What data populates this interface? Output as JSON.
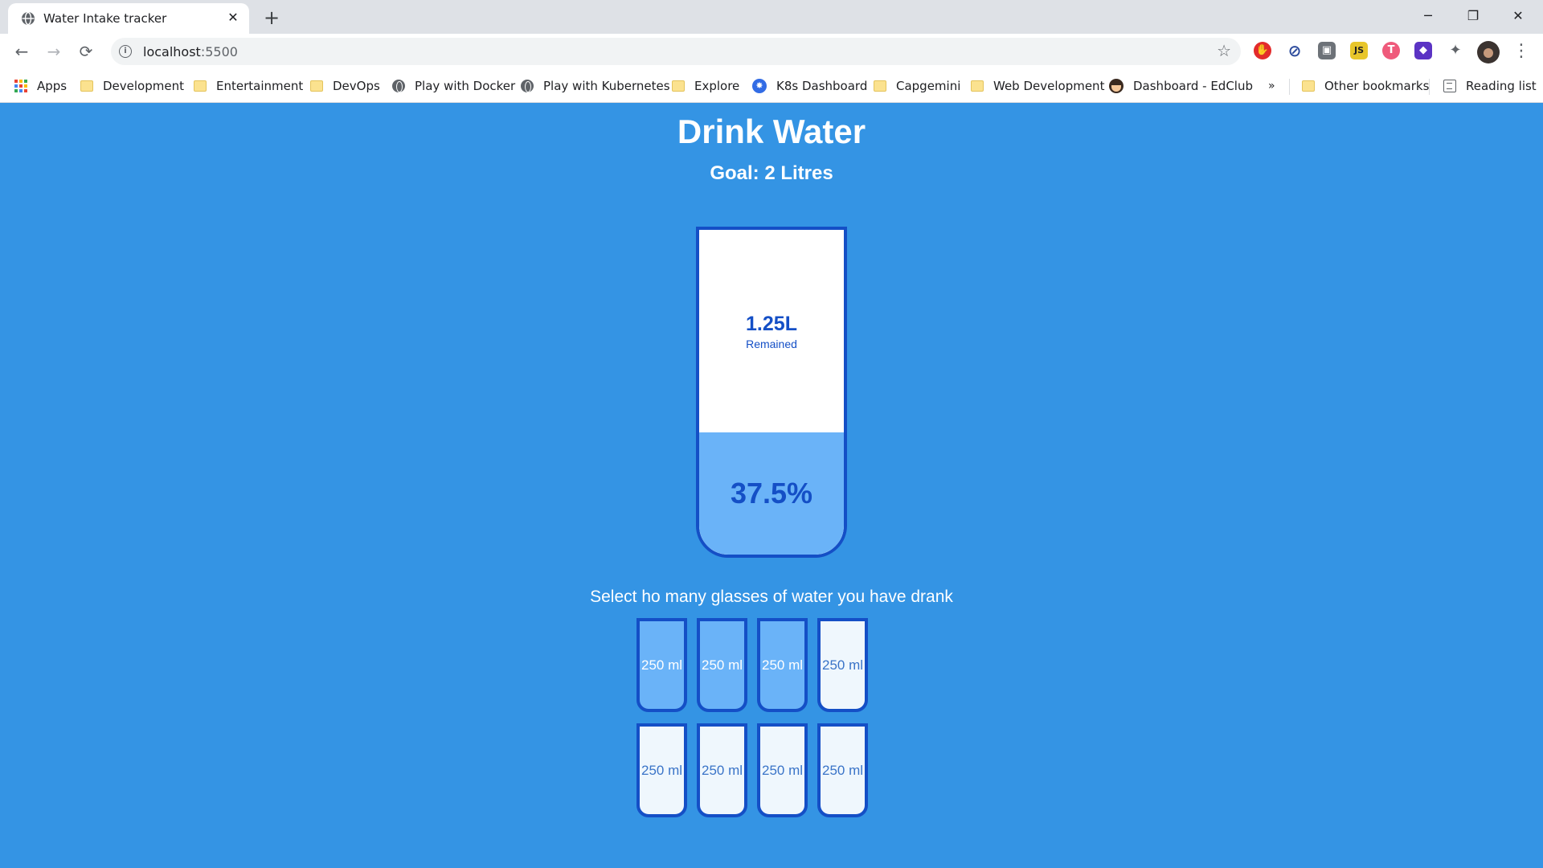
{
  "browser": {
    "tab": {
      "title": "Water Intake tracker",
      "close": "✕",
      "favicon": "globe-icon"
    },
    "new_tab": "+",
    "window_controls": {
      "minimize": "─",
      "restore": "❐",
      "close": "✕"
    },
    "nav": {
      "back": "←",
      "forward": "→",
      "reload": "⟳"
    },
    "omnibox": {
      "host": "localhost",
      "port": ":5500",
      "info": "i",
      "star": "☆"
    },
    "extensions": [
      {
        "name": "adblock-extension-icon",
        "glyph": "✋",
        "color": "#e32b2b"
      },
      {
        "name": "block-extension-icon",
        "glyph": "⊘",
        "color": "#2c4b9c"
      },
      {
        "name": "portrait-extension-icon",
        "glyph": "▣",
        "color": "#6d7278"
      },
      {
        "name": "js-extension-icon",
        "glyph": "JS",
        "color": "#e8c62b"
      },
      {
        "name": "t-extension-icon",
        "glyph": "T",
        "color": "#ef5a7b"
      },
      {
        "name": "grad-cap-extension-icon",
        "glyph": "◆",
        "color": "#5b33c4"
      },
      {
        "name": "puzzle-extension-icon",
        "glyph": "✦",
        "color": "#5f6368"
      }
    ],
    "menu": "⋮",
    "bookmarks": [
      {
        "label": "Apps",
        "icon": "apps-grid"
      },
      {
        "label": "Development",
        "icon": "folder"
      },
      {
        "label": "Entertainment",
        "icon": "folder"
      },
      {
        "label": "DevOps",
        "icon": "folder"
      },
      {
        "label": "Play with Docker",
        "icon": "globe"
      },
      {
        "label": "Play with Kubernetes",
        "icon": "globe"
      },
      {
        "label": "Explore",
        "icon": "folder"
      },
      {
        "label": "K8s Dashboard",
        "icon": "k8s"
      },
      {
        "label": "Capgemini",
        "icon": "folder"
      },
      {
        "label": "Web Development",
        "icon": "folder"
      },
      {
        "label": "Dashboard - EdClub",
        "icon": "edclub"
      }
    ],
    "bookmarks_overflow": "»",
    "other_bookmarks": "Other bookmarks",
    "reading_list": "Reading list"
  },
  "app": {
    "title": "Drink Water",
    "goal": "Goal: 2 Litres",
    "remained_value": "1.25L",
    "remained_label": "Remained",
    "percentage_text": "37.5%",
    "fill_fraction": 0.375,
    "select_text": "Select ho many glasses of water you have drank",
    "cups": [
      {
        "label": "250 ml",
        "full": true
      },
      {
        "label": "250 ml",
        "full": true
      },
      {
        "label": "250 ml",
        "full": true
      },
      {
        "label": "250 ml",
        "full": false
      },
      {
        "label": "250 ml",
        "full": false
      },
      {
        "label": "250 ml",
        "full": false
      },
      {
        "label": "250 ml",
        "full": false
      },
      {
        "label": "250 ml",
        "full": false
      }
    ]
  },
  "colors": {
    "page_bg": "#3494e4",
    "cup_border": "#144fc6",
    "water": "#6ab3f8"
  }
}
